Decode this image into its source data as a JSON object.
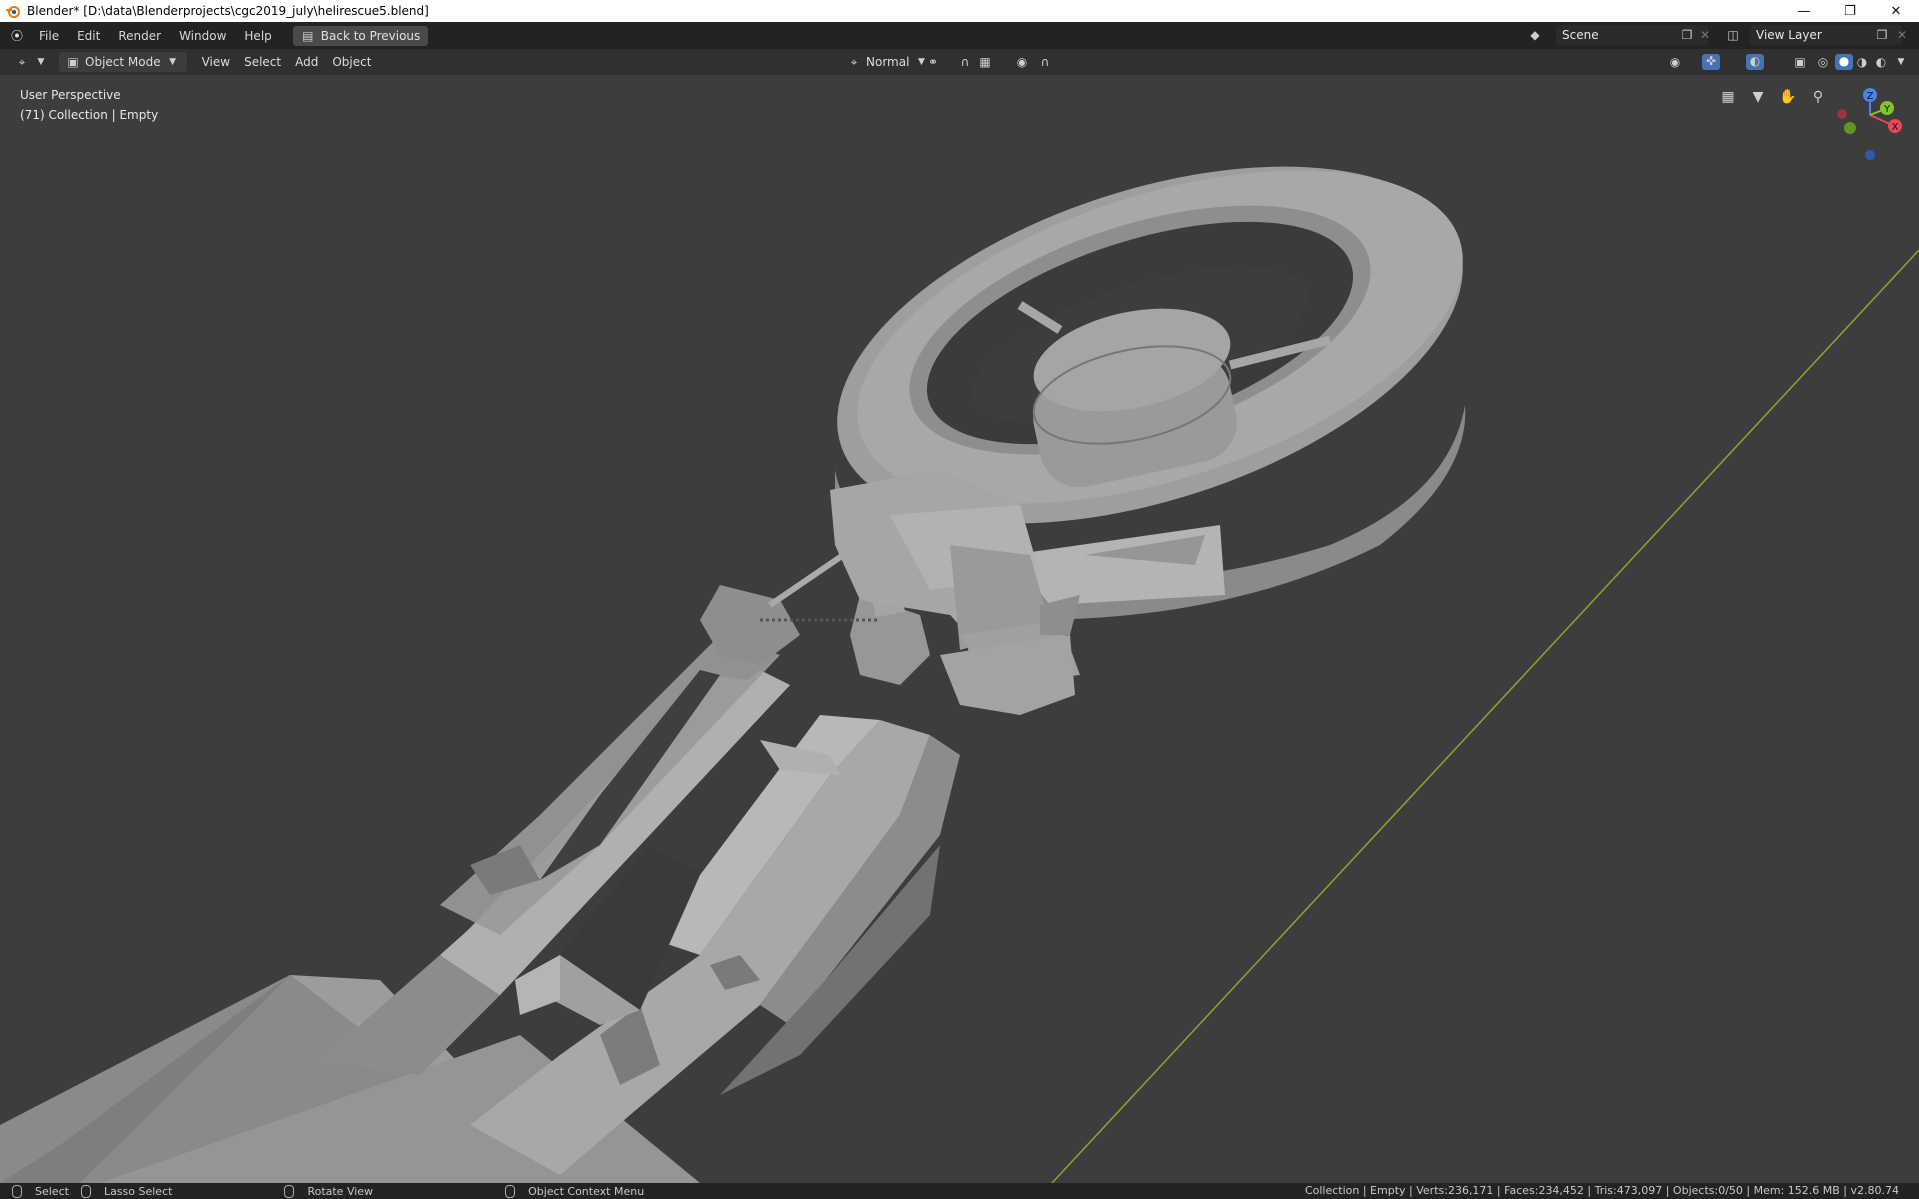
{
  "window": {
    "title": "Blender* [D:\\data\\Blenderprojects\\cgc2019_july\\helirescue5.blend]",
    "controls": [
      "minimize",
      "restore",
      "close"
    ]
  },
  "menubar": {
    "items": [
      "File",
      "Edit",
      "Render",
      "Window",
      "Help"
    ],
    "back_button": "Back to Previous",
    "scene": "Scene",
    "view_layer": "View Layer"
  },
  "toolbar": {
    "mode": "Object Mode",
    "menus": [
      "View",
      "Select",
      "Add",
      "Object"
    ],
    "orientation": "Normal"
  },
  "viewport": {
    "perspective_label": "User Perspective",
    "collection_label": "(71) Collection | Empty",
    "gizmo_axes": [
      "Z",
      "Y",
      "X"
    ],
    "background_color": "#3d3d3d",
    "grid_axis_color": "#8ea62c"
  },
  "statusbar": {
    "select": "Select",
    "lasso": "Lasso Select",
    "rotate": "Rotate View",
    "context": "Object Context Menu",
    "stats": "Collection | Empty | Verts:236,171 | Faces:234,452 | Tris:473,097 | Objects:0/50 | Mem: 152.6 MB | v2.80.74"
  }
}
